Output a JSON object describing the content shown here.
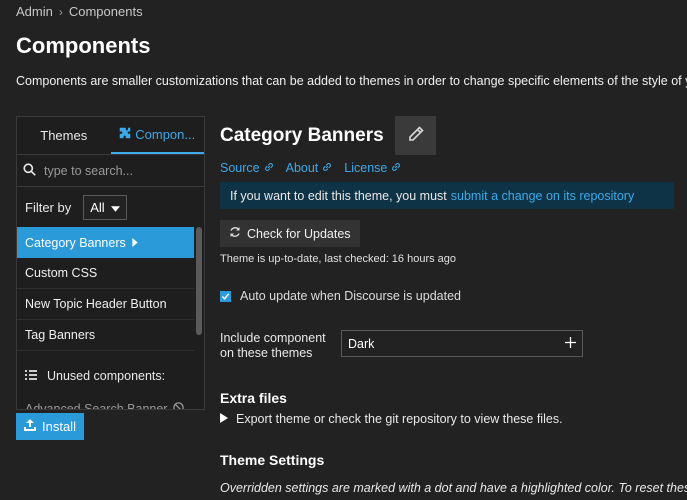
{
  "breadcrumb": {
    "root": "Admin",
    "current": "Components"
  },
  "page": {
    "title": "Components",
    "description": "Components are smaller customizations that can be added to themes in order to change specific elements of the style of your forum design"
  },
  "left_panel": {
    "tabs": [
      {
        "label": "Themes",
        "active": false
      },
      {
        "label": "Compon...",
        "active": true
      }
    ],
    "search_placeholder": "type to search...",
    "filter_label": "Filter by",
    "filter_value": "All",
    "items": [
      {
        "label": "Category Banners",
        "selected": true
      },
      {
        "label": "Custom CSS",
        "selected": false
      },
      {
        "label": "New Topic Header Button",
        "selected": false
      },
      {
        "label": "Tag Banners",
        "selected": false
      }
    ],
    "unused_label": "Unused components:",
    "unused_items": [
      {
        "label": "Advanced Search Banner"
      }
    ],
    "install_label": "Install"
  },
  "component": {
    "title": "Category Banners",
    "links": [
      "Source",
      "About",
      "License"
    ],
    "notice_text": "If you want to edit this theme, you must",
    "notice_link": "submit a change on its repository",
    "check_updates_label": "Check for Updates",
    "status_text": "Theme is up-to-date, last checked: 16 hours ago",
    "auto_update_label": "Auto update when Discourse is updated",
    "auto_update_checked": true,
    "include_label": "Include component on these themes",
    "include_value": "Dark",
    "extra_files_title": "Extra files",
    "extra_files_desc": "Export theme or check the git repository to view these files.",
    "theme_settings_title": "Theme Settings",
    "theme_settings_desc": "Overridden settings are marked with a dot and have a highlighted color. To reset these"
  },
  "colors": {
    "accent": "#2a9bd8",
    "link": "#3ea9e8",
    "background": "#222222",
    "notice_bg": "#0f3346"
  }
}
